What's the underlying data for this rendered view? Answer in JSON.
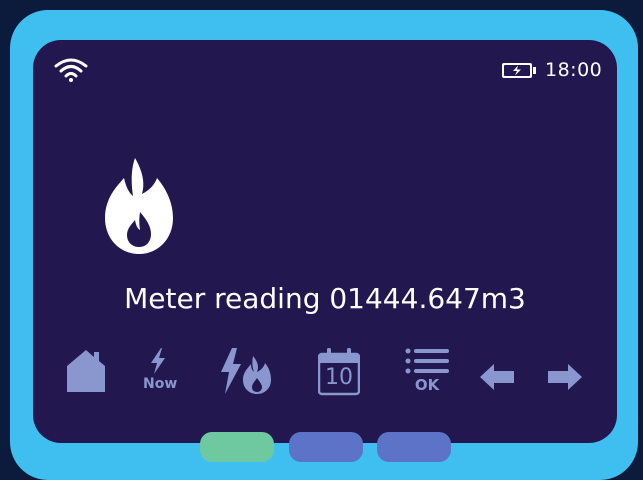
{
  "status_bar": {
    "wifi_icon": "wifi-icon",
    "battery_icon": "battery-charging-icon",
    "time": "18:00"
  },
  "main": {
    "fuel_icon": "gas-flame-icon",
    "reading_label": "Meter reading 01444.647m3"
  },
  "toolbar": {
    "home_icon": "home-icon",
    "now_label": "Now",
    "electricity_gas_icon": "electricity-gas-icon",
    "calendar_day": "10",
    "ok_label": "OK",
    "back_icon": "arrow-left-icon",
    "forward_icon": "arrow-right-icon"
  },
  "colors": {
    "device_frame": "#3fbff0",
    "screen": "#22184f",
    "icon_muted": "#8a97cf",
    "hardware_button_green": "#6fc9a0",
    "hardware_button_blue": "#5d73c8"
  }
}
